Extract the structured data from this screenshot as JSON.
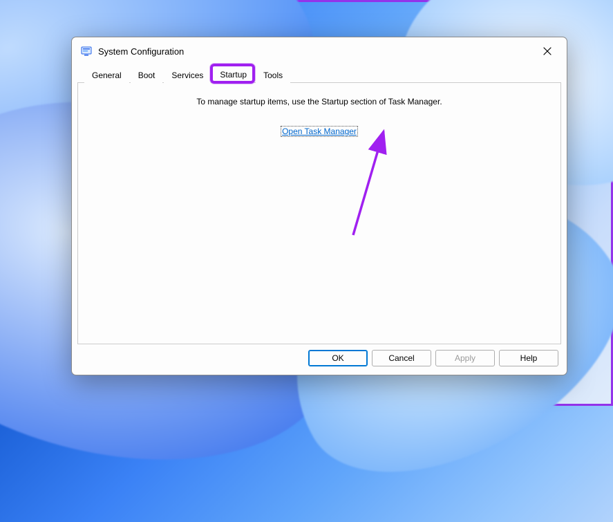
{
  "window": {
    "title": "System Configuration"
  },
  "tabs": {
    "general": "General",
    "boot": "Boot",
    "services": "Services",
    "startup": "Startup",
    "tools": "Tools"
  },
  "content": {
    "instruction": "To manage startup items, use the Startup section of Task Manager.",
    "link": "Open Task Manager"
  },
  "buttons": {
    "ok": "OK",
    "cancel": "Cancel",
    "apply": "Apply",
    "help": "Help"
  }
}
